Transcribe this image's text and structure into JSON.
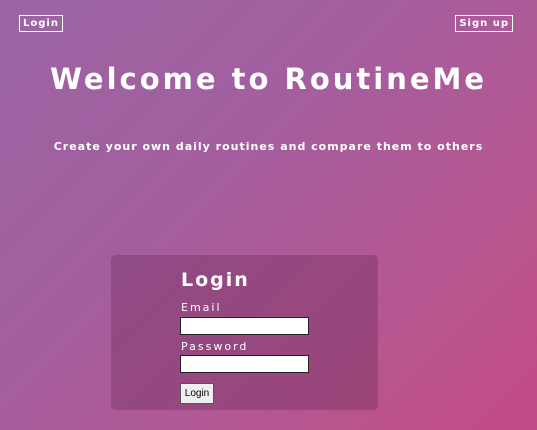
{
  "nav": {
    "login_label": "Login",
    "signup_label": "Sign up"
  },
  "hero": {
    "title": "Welcome to RoutineMe",
    "subtitle": "Create your own daily routines and compare them to others"
  },
  "login_form": {
    "heading": "Login",
    "email_label": "Email",
    "email_value": "",
    "password_label": "Password",
    "password_value": "",
    "submit_label": "Login"
  },
  "colors": {
    "background_start": "#9a65a3",
    "background_end": "#c34a89",
    "card_background": "#8e4a7f",
    "text": "#ffffff"
  }
}
